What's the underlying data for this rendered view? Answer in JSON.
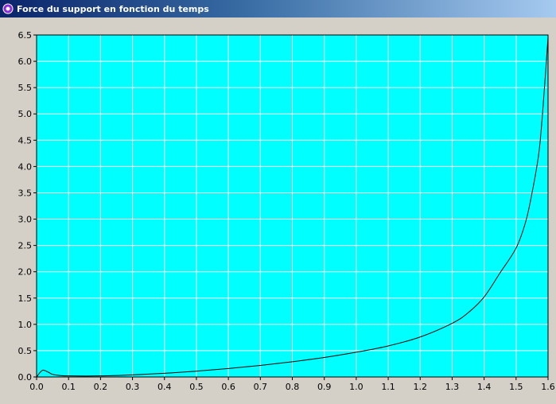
{
  "window": {
    "title": "Force du support en fonction du temps",
    "icon": "app-icon"
  },
  "colors": {
    "plot_background": "#00ffff",
    "grid": "#ffffff",
    "curve": "#000000",
    "frame": "#d4d0c8"
  },
  "chart_data": {
    "type": "line",
    "title": "",
    "xlabel": "",
    "ylabel": "",
    "xlim": [
      0.0,
      1.6
    ],
    "ylim": [
      0.0,
      6.5
    ],
    "grid": true,
    "x_ticks": [
      "0.0",
      "0.1",
      "0.2",
      "0.3",
      "0.4",
      "0.5",
      "0.6",
      "0.7",
      "0.8",
      "0.9",
      "1.0",
      "1.1",
      "1.2",
      "1.3",
      "1.4",
      "1.5",
      "1.6"
    ],
    "y_ticks": [
      "0.0",
      "0.5",
      "1.0",
      "1.5",
      "2.0",
      "2.5",
      "3.0",
      "3.5",
      "4.0",
      "4.5",
      "5.0",
      "5.5",
      "6.0",
      "6.5"
    ],
    "series": [
      {
        "x": [
          0.0,
          0.01,
          0.02,
          0.03,
          0.04,
          0.05,
          0.07,
          0.1,
          0.2,
          0.3,
          0.4,
          0.5,
          0.6,
          0.7,
          0.8,
          0.9,
          1.0,
          1.1,
          1.2,
          1.3,
          1.35,
          1.4,
          1.45,
          1.5,
          1.53,
          1.55,
          1.57,
          1.58,
          1.59,
          1.6
        ],
        "y": [
          0.0,
          0.08,
          0.13,
          0.11,
          0.08,
          0.05,
          0.03,
          0.02,
          0.02,
          0.04,
          0.07,
          0.11,
          0.16,
          0.22,
          0.29,
          0.37,
          0.47,
          0.59,
          0.76,
          1.02,
          1.22,
          1.52,
          1.98,
          2.45,
          2.95,
          3.5,
          4.2,
          4.8,
          5.6,
          6.45
        ]
      }
    ]
  }
}
